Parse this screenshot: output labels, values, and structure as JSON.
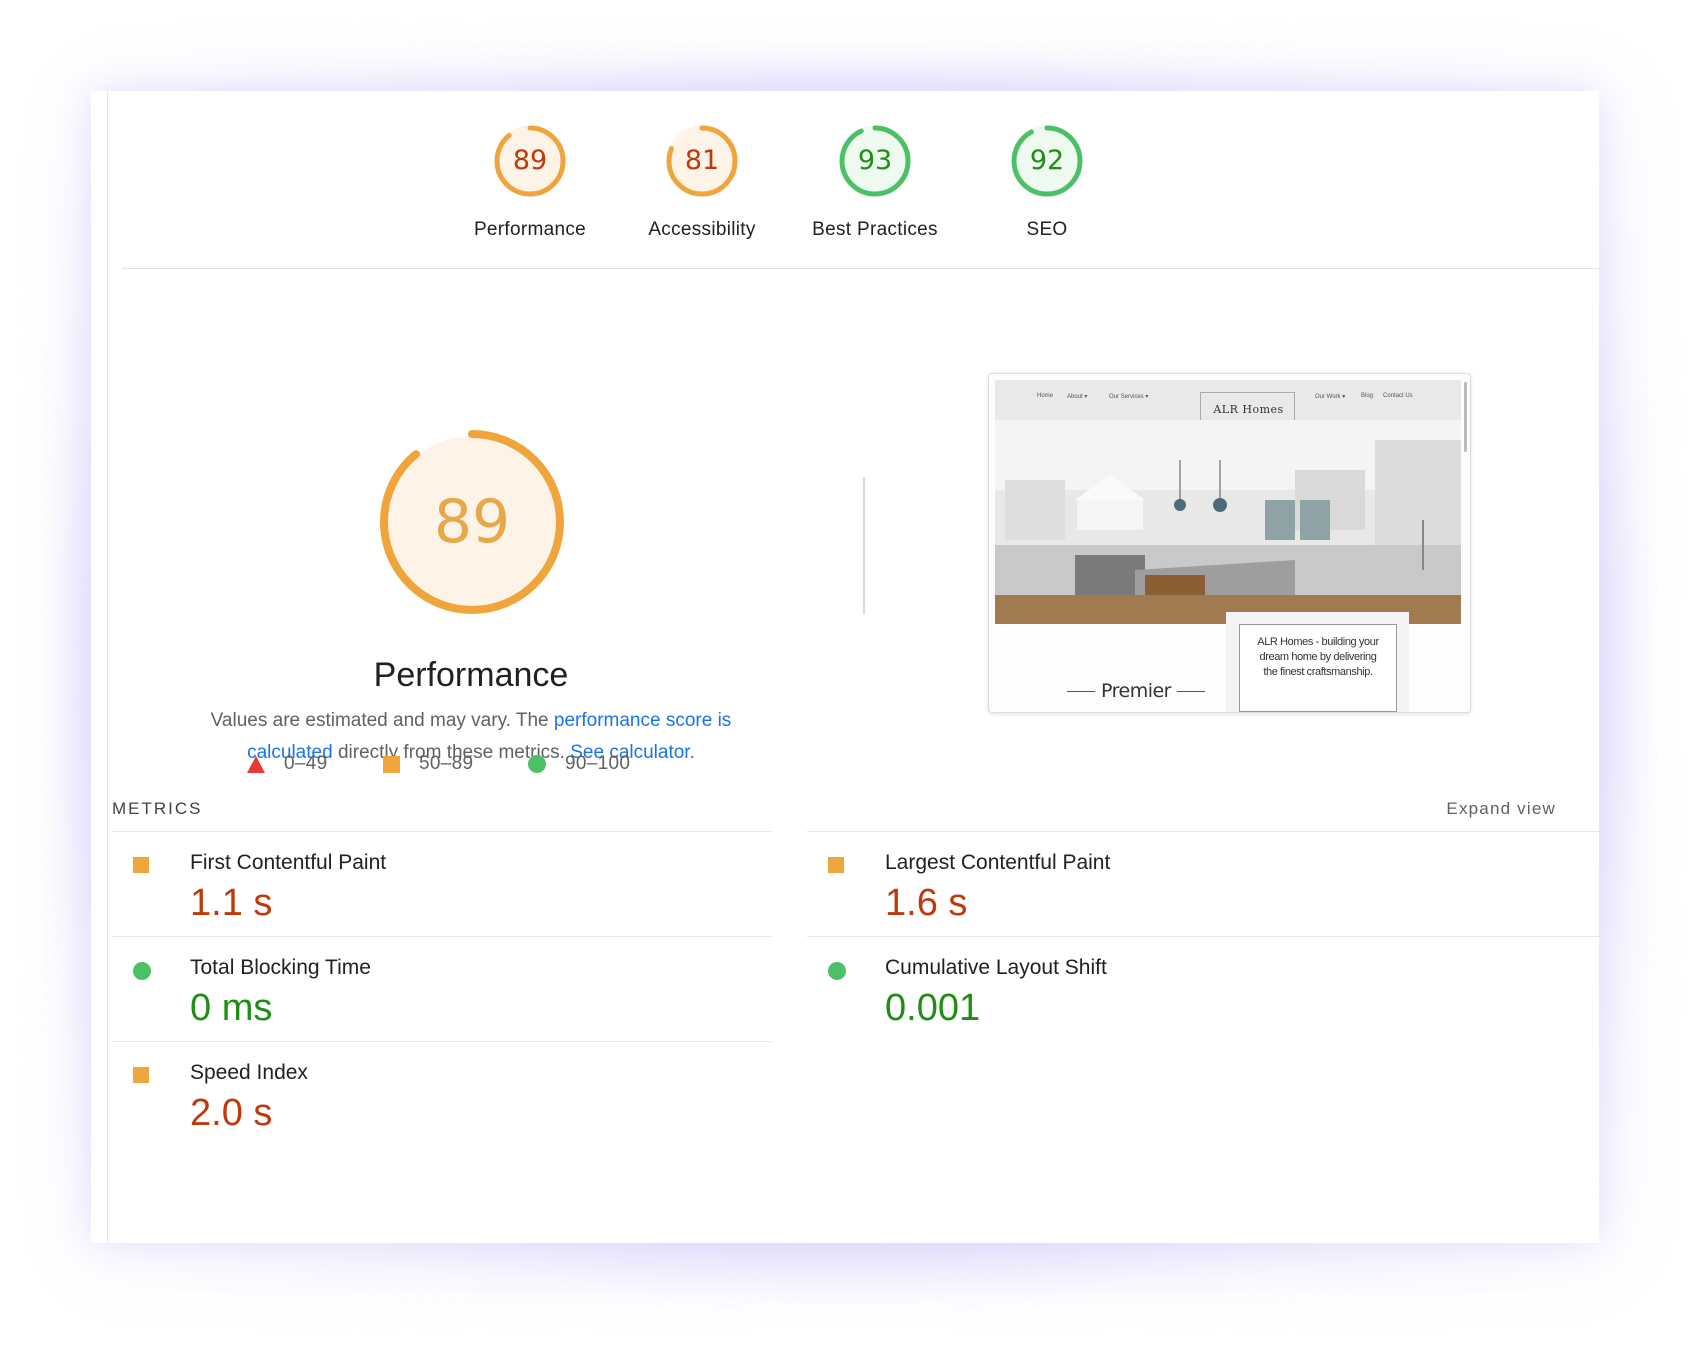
{
  "scores": [
    {
      "value": "89",
      "label": "Performance",
      "fraction": 0.89,
      "ring_color": "#f0a43c",
      "fill_color": "#fdf3e6",
      "text_color": "#c0390b"
    },
    {
      "value": "81",
      "label": "Accessibility",
      "fraction": 0.81,
      "ring_color": "#f0a43c",
      "fill_color": "#fdf3e6",
      "text_color": "#c0390b"
    },
    {
      "value": "93",
      "label": "Best Practices",
      "fraction": 0.93,
      "ring_color": "#4cc066",
      "fill_color": "#eefaf0",
      "text_color": "#1e8e14"
    },
    {
      "value": "92",
      "label": "SEO",
      "fraction": 0.92,
      "ring_color": "#4cc066",
      "fill_color": "#eefaf0",
      "text_color": "#1e8e14"
    }
  ],
  "main": {
    "score": "89",
    "fraction": 0.89,
    "title": "Performance",
    "desc_pre": "Values are estimated and may vary. The ",
    "desc_link1": "performance score is calculated",
    "desc_mid": " directly from these metrics. ",
    "desc_link2": "See calculator",
    "desc_post": "."
  },
  "legend": [
    {
      "shape": "triangle",
      "range": "0–49",
      "color": "#e53935"
    },
    {
      "shape": "square",
      "range": "50–89",
      "color": "#f0a43c"
    },
    {
      "shape": "circle",
      "range": "90–100",
      "color": "#4cc066"
    }
  ],
  "preview": {
    "nav": [
      "Home",
      "About ▾",
      "Our Services ▾",
      "Our Work ▾",
      "Blog",
      "Contact Us"
    ],
    "logo": "ALR Homes",
    "caption": "Premier",
    "box_text": "ALR Homes - building your dream home by delivering the finest craftsmanship."
  },
  "metrics": {
    "heading": "METRICS",
    "expand": "Expand view",
    "items": [
      {
        "title": "First Contentful Paint",
        "value": "1.1 s",
        "status": "average"
      },
      {
        "title": "Largest Contentful Paint",
        "value": "1.6 s",
        "status": "average"
      },
      {
        "title": "Total Blocking Time",
        "value": "0 ms",
        "status": "good"
      },
      {
        "title": "Cumulative Layout Shift",
        "value": "0.001",
        "status": "good"
      },
      {
        "title": "Speed Index",
        "value": "2.0 s",
        "status": "average"
      }
    ]
  }
}
